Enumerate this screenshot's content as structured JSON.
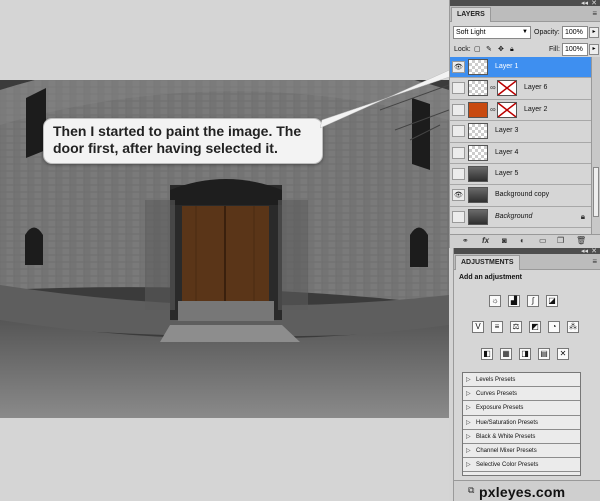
{
  "callout": {
    "text": "Then I started to paint the image. The door first, after having selected it."
  },
  "layers_panel": {
    "tab_label": "LAYERS",
    "blend_mode": "Soft Light",
    "opacity_label": "Opacity:",
    "opacity_value": "100%",
    "lock_label": "Lock:",
    "fill_label": "Fill:",
    "fill_value": "100%",
    "layers": [
      {
        "name": "Layer 1",
        "selected": true,
        "visible": true,
        "thumb": "checker",
        "mask": false
      },
      {
        "name": "Layer 6",
        "selected": false,
        "visible": false,
        "thumb": "checker",
        "mask": true
      },
      {
        "name": "Layer 2",
        "selected": false,
        "visible": false,
        "thumb": "orange",
        "mask": true
      },
      {
        "name": "Layer 3",
        "selected": false,
        "visible": false,
        "thumb": "checker",
        "mask": false
      },
      {
        "name": "Layer 4",
        "selected": false,
        "visible": false,
        "thumb": "checker",
        "mask": false
      },
      {
        "name": "Layer 5",
        "selected": false,
        "visible": false,
        "thumb": "photo",
        "mask": false
      },
      {
        "name": "Background copy",
        "selected": false,
        "visible": true,
        "thumb": "photo",
        "mask": false
      },
      {
        "name": "Background",
        "selected": false,
        "visible": false,
        "thumb": "photo",
        "mask": false,
        "italic": true,
        "locked": true
      }
    ]
  },
  "adjustments_panel": {
    "tab_label": "ADJUSTMENTS",
    "subtitle": "Add an adjustment",
    "presets": [
      "Levels Presets",
      "Curves Presets",
      "Exposure Presets",
      "Hue/Saturation Presets",
      "Black & White Presets",
      "Channel Mixer Presets",
      "Selective Color Presets"
    ]
  },
  "watermark": "pxleyes.com",
  "colors": {
    "selection": "#3e8ff0",
    "door": "#5a3518",
    "panel": "#d6d6d6"
  }
}
